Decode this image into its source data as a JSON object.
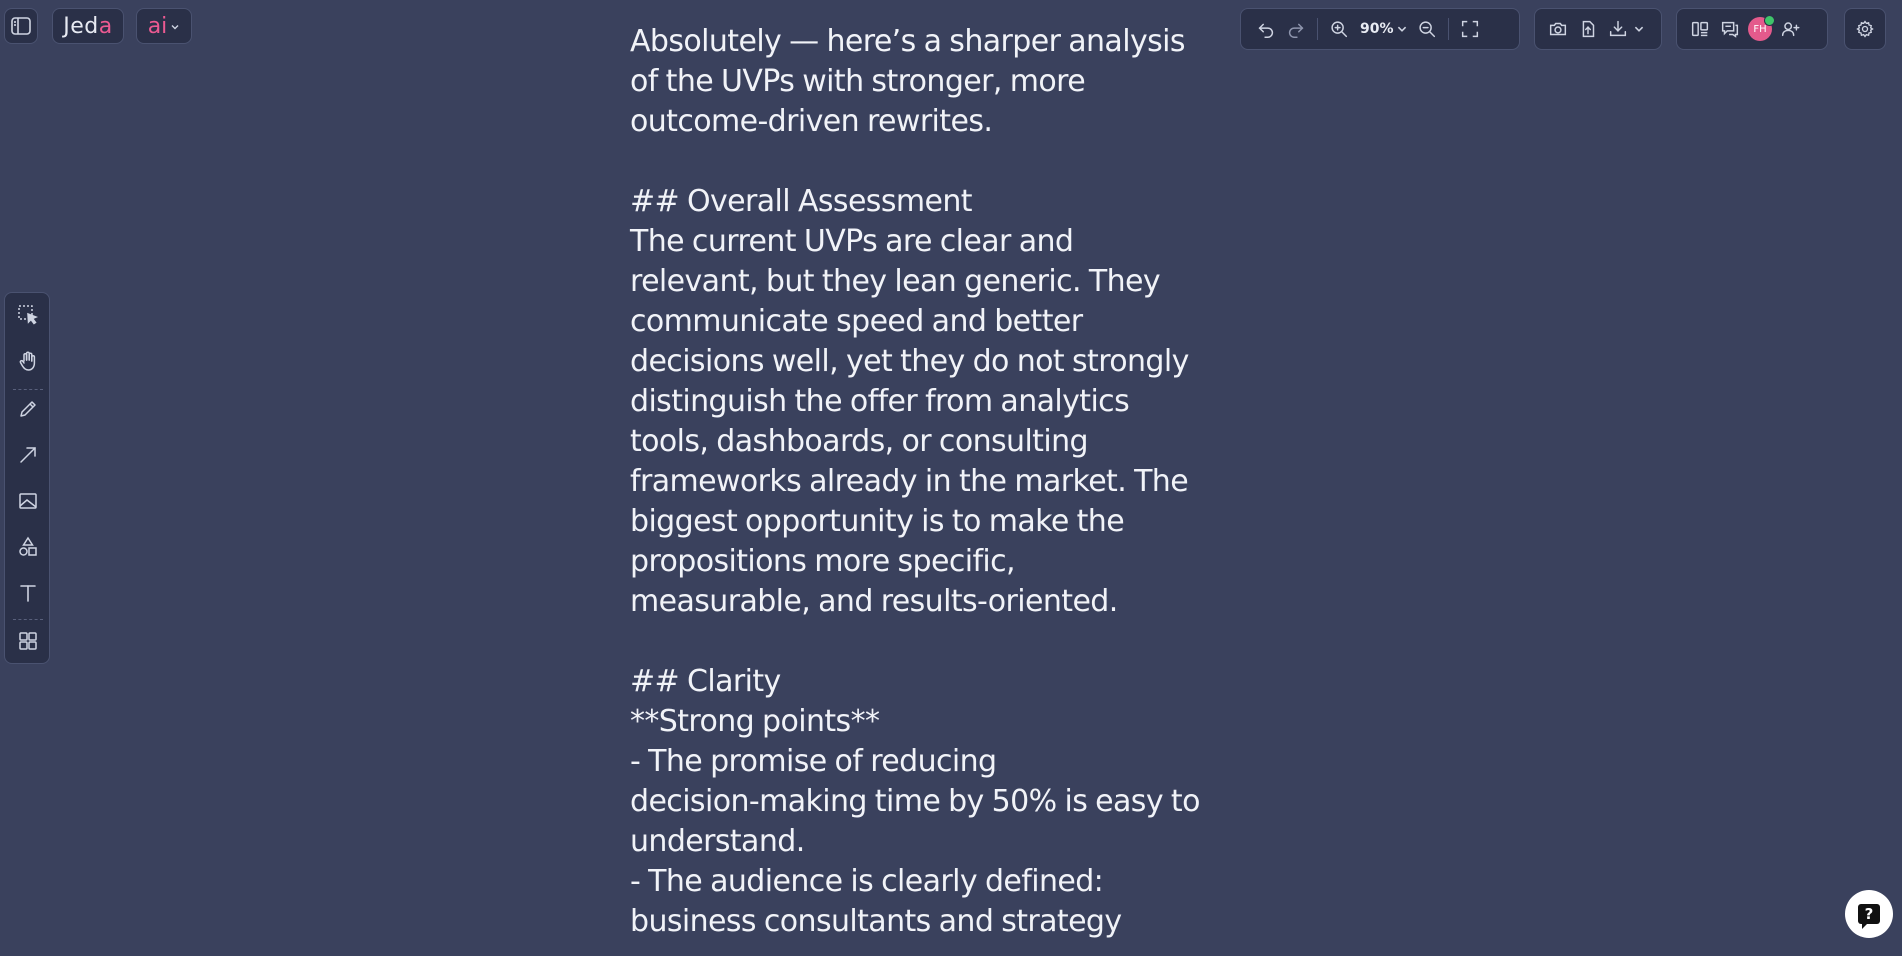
{
  "app": {
    "logo_main": "Jed",
    "logo_accent": "a",
    "ai_label": "ai"
  },
  "toolbar": {
    "zoom_level": "90%",
    "avatar_initials": "FH"
  },
  "colors": {
    "background": "#3a415d",
    "panel": "#2a3048",
    "accent_pink": "#ec5a92",
    "presence_green": "#3fc46a",
    "text": "#f1f3f8"
  },
  "icons": {
    "top_left": [
      "sidebar-toggle-icon",
      "chevron-down-icon"
    ],
    "history": [
      "undo-icon",
      "redo-icon",
      "zoom-in-icon",
      "chevron-down-icon",
      "zoom-out-icon",
      "fit-screen-icon"
    ],
    "export": [
      "camera-icon",
      "share-icon",
      "download-icon",
      "chevron-down-icon"
    ],
    "collab": [
      "layout-icon",
      "comments-icon",
      "add-user-icon"
    ],
    "settings": [
      "gear-icon"
    ],
    "tools": [
      "select-icon",
      "hand-icon",
      "pencil-icon",
      "arrow-icon",
      "image-icon",
      "shapes-icon",
      "text-icon",
      "templates-icon"
    ],
    "help": [
      "help-icon"
    ]
  },
  "document": {
    "lines": [
      "Absolutely — here’s a sharper analysis",
      "of the UVPs with stronger, more",
      "outcome-driven rewrites.",
      "",
      "## Overall Assessment",
      "The current UVPs are clear and",
      "relevant, but they lean generic. They",
      "communicate speed and better",
      "decisions well, yet they do not strongly",
      "distinguish the offer from analytics",
      "tools, dashboards, or consulting",
      "frameworks already in the market. The",
      "biggest opportunity is to make the",
      "propositions more specific,",
      "measurable, and results-oriented.",
      "",
      "## Clarity",
      "**Strong points**",
      "- The promise of reducing",
      "decision-making time by 50% is easy to",
      "understand.",
      "- The audience is clearly defined:",
      "business consultants and strategy"
    ]
  },
  "help": {
    "label": "?"
  }
}
